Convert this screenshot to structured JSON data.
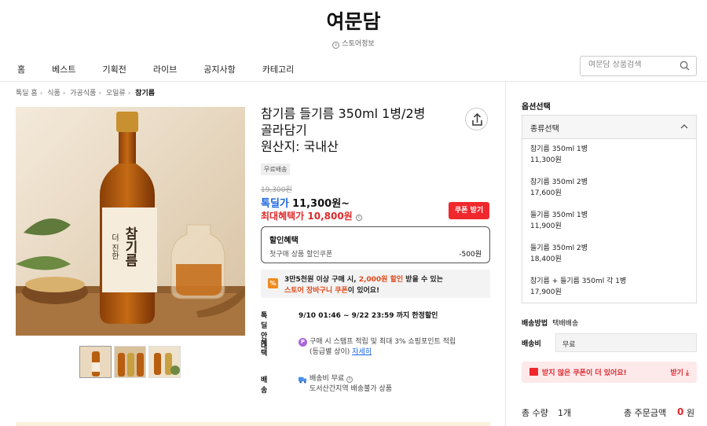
{
  "store": {
    "name": "여문담",
    "info_label": "스토어정보"
  },
  "nav": [
    "홈",
    "베스트",
    "기획전",
    "라이브",
    "공지사항",
    "카테고리"
  ],
  "search": {
    "placeholder": "여문담 상품검색"
  },
  "breadcrumb": [
    "톡딜 홈",
    "식품",
    "가공식품",
    "오일류",
    "참기름"
  ],
  "product": {
    "title_lines": [
      "참기름 들기름 350ml 1병/2병",
      "골라담기",
      "원산지: 국내산"
    ],
    "free_shipping_badge": "무료배송",
    "original_price": "19,300원",
    "deal_label": "톡딜가",
    "deal_price": "11,300원~",
    "max_benefit": "최대혜택가 10,800원",
    "coupon_button": "쿠폰 받기",
    "bottle_label": "참기름",
    "bottle_label_sub": "더 진한"
  },
  "discount": {
    "title": "할인혜택",
    "item_label": "첫구매 상품 할인쿠폰",
    "item_value": "-500원"
  },
  "promo": {
    "line1_a": "3만5천원 이상 구매 시, ",
    "line1_hl": "2,000원 할인",
    "line1_b": " 받을 수 있는",
    "line2_hl": "스토어 장바구니 쿠폰",
    "line2_b": "이 있어요!",
    "icon": "%"
  },
  "deal_info": {
    "label": "톡딜 안내",
    "value": "9/10 01:46 ~ 9/22 23:59 까지 한정할인"
  },
  "benefit": {
    "label": "혜택",
    "icon": "P",
    "line1": "구매 시 스탬프 적립 및 최대 3% 쇼핑포인트 적립",
    "line2": "(등급별 상이)",
    "link": "자세히"
  },
  "shipping": {
    "label": "배송",
    "line1": "배송비 무료",
    "line2": "도서산간지역 배송불가 상품"
  },
  "options": {
    "title": "옵션선택",
    "select_label": "종류선택",
    "items": [
      {
        "name": "참기름 350ml 1병",
        "price": "11,300원"
      },
      {
        "name": "참기름 350ml 2병",
        "price": "17,600원"
      },
      {
        "name": "들기름 350ml 1병",
        "price": "11,900원"
      },
      {
        "name": "들기름 350ml 2병",
        "price": "18,400원"
      },
      {
        "name": "참기름 + 들기름 350ml 각 1병",
        "price": "17,900원"
      }
    ]
  },
  "delivery": {
    "method_label": "배송방법",
    "method_value": "택배배송",
    "fee_label": "배송비",
    "fee_value": "무료"
  },
  "unclaimed": {
    "message": "받지 않은 쿠폰이 더 있어요!",
    "action": "받기"
  },
  "total": {
    "qty_label": "총 수량",
    "qty_value": "1개",
    "amount_label": "총 주문금액",
    "amount_value": "0",
    "currency": "원"
  },
  "colors": {
    "accent_red": "#f0282d",
    "deal_blue": "#1a66e0",
    "promo_orange": "#f08a1e"
  }
}
